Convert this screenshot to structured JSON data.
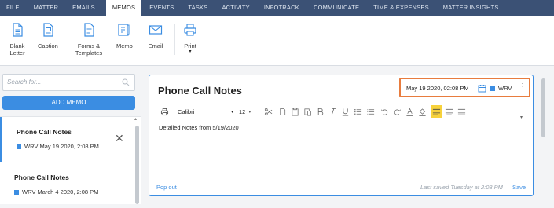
{
  "nav": {
    "tabs": [
      "FILE",
      "MATTER",
      "EMAILS",
      "MEMOS",
      "EVENTS",
      "TASKS",
      "ACTIVITY",
      "INFOTRACK",
      "COMMUNICATE",
      "TIME & EXPENSES",
      "MATTER INSIGHTS"
    ],
    "active": "MEMOS"
  },
  "ribbon": {
    "blank_letter": "Blank Letter",
    "caption": "Caption",
    "forms_templates": "Forms & Templates",
    "memo": "Memo",
    "email": "Email",
    "print": "Print"
  },
  "sidebar": {
    "search_placeholder": "Search for...",
    "add_memo": "ADD MEMO",
    "items": [
      {
        "title": "Phone Call Notes",
        "user": "WRV",
        "date": "May 19 2020, 2:08 PM"
      },
      {
        "title": "Phone Call Notes",
        "user": "WRV",
        "date": "March 4 2020, 2:08 PM"
      }
    ]
  },
  "editor": {
    "title": "Phone Call Notes",
    "datetime": "May 19 2020, 02:08 PM",
    "user": "WRV",
    "font": "Calibri",
    "size": "12",
    "content": "Detailed Notes from 5/19/2020",
    "popout": "Pop out",
    "last_saved": "Last saved Tuesday at 2:08 PM",
    "save": "Save"
  },
  "colors": {
    "nav_bg": "#3b5175",
    "accent": "#3b8de2",
    "highlight_border": "#e87c3e",
    "align_active": "#f7d23c"
  }
}
